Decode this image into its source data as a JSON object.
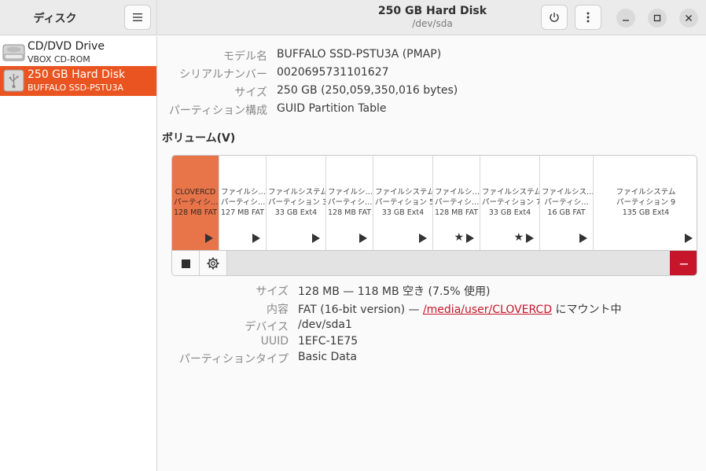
{
  "header": {
    "app_title": "ディスク",
    "disk_title": "250 GB Hard Disk",
    "disk_subtitle": "/dev/sda"
  },
  "sidebar": {
    "drives": [
      {
        "name": "CD/DVD Drive",
        "model": "VBOX CD-ROM",
        "icon": "optical-drive-icon",
        "selected": false
      },
      {
        "name": "250 GB Hard Disk",
        "model": "BUFFALO SSD-PSTU3A",
        "icon": "usb-drive-icon",
        "selected": true
      }
    ]
  },
  "disk_info": [
    {
      "label": "モデル名",
      "value": "BUFFALO SSD-PSTU3A (PMAP)"
    },
    {
      "label": "シリアルナンバー",
      "value": "0020695731101627"
    },
    {
      "label": "サイズ",
      "value": "250 GB (250,059,350,016 bytes)"
    },
    {
      "label": "パーティション構成",
      "value": "GUID Partition Table"
    }
  ],
  "volumes": {
    "heading": "ボリューム(V)",
    "partitions": [
      {
        "line1": "CLOVERCD",
        "line2": "パーティシ…",
        "line3": "128 MB FAT",
        "selected": true,
        "star": false
      },
      {
        "line1": "ファイルシ…",
        "line2": "パーティシ…",
        "line3": "127 MB FAT",
        "selected": false,
        "star": false
      },
      {
        "line1": "ファイルシステム",
        "line2": "パーティション 3",
        "line3": "33 GB Ext4",
        "selected": false,
        "star": false
      },
      {
        "line1": "ファイルシ…",
        "line2": "パーティシ…",
        "line3": "128 MB FAT",
        "selected": false,
        "star": false
      },
      {
        "line1": "ファイルシステム",
        "line2": "パーティション 5",
        "line3": "33 GB Ext4",
        "selected": false,
        "star": false
      },
      {
        "line1": "ファイルシ…",
        "line2": "パーティシ…",
        "line3": "128 MB FAT",
        "selected": false,
        "star": true
      },
      {
        "line1": "ファイルシステム",
        "line2": "パーティション 7",
        "line3": "33 GB Ext4",
        "selected": false,
        "star": true
      },
      {
        "line1": "ファイルシス…",
        "line2": "パーティシ…",
        "line3": "16 GB FAT",
        "selected": false,
        "star": false
      },
      {
        "line1": "ファイルシステム",
        "line2": "パーティション 9",
        "line3": "135 GB Ext4",
        "selected": false,
        "star": false
      }
    ],
    "delete_label": "−"
  },
  "partition_info": {
    "size_label": "サイズ",
    "size_value": "128 MB — 118 MB 空き (7.5% 使用)",
    "contents_label": "内容",
    "contents_prefix": "FAT (16-bit version) — ",
    "contents_link": "/media/user/CLOVERCD",
    "contents_suffix": " にマウント中",
    "device_label": "デバイス",
    "device_value": "/dev/sda1",
    "uuid_label": "UUID",
    "uuid_value": "1EFC-1E75",
    "ptype_label": "パーティションタイプ",
    "ptype_value": "Basic Data"
  },
  "colors": {
    "accent": "#e95420",
    "danger": "#c7162b"
  }
}
